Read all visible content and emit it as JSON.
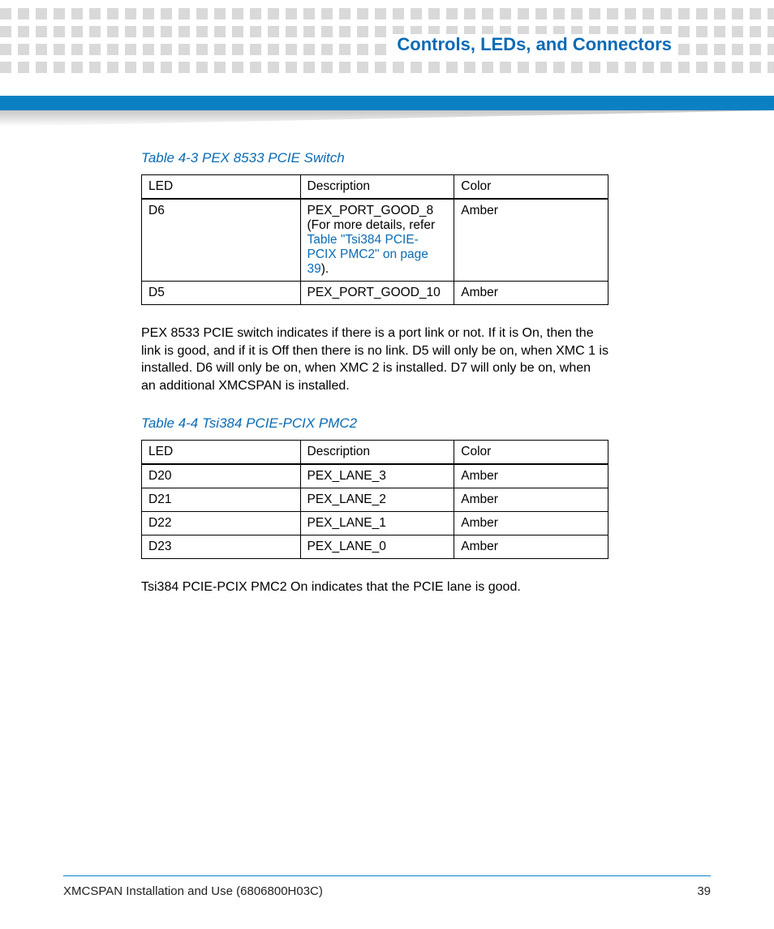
{
  "header": {
    "title": "Controls, LEDs, and Connectors"
  },
  "table1": {
    "caption": "Table 4-3 PEX 8533 PCIE Switch",
    "headers": {
      "led": "LED",
      "desc": "Description",
      "color": "Color"
    },
    "rows": [
      {
        "led": "D6",
        "desc_pre": "PEX_PORT_GOOD_8 (For more details, refer ",
        "desc_link": "Table \"Tsi384 PCIE-PCIX PMC2\" on page 39",
        "desc_post": ").",
        "color": "Amber"
      },
      {
        "led": "D5",
        "desc_pre": "PEX_PORT_GOOD_10",
        "desc_link": "",
        "desc_post": "",
        "color": "Amber"
      }
    ]
  },
  "para1": "PEX 8533 PCIE switch indicates if there is a port link or not. If it is On, then the link is good, and if it is Off then there is no link. D5 will only be on, when XMC 1 is installed. D6 will only be on, when XMC 2 is installed. D7 will only be on, when an additional XMCSPAN is installed.",
  "table2": {
    "caption": "Table 4-4 Tsi384 PCIE-PCIX PMC2",
    "headers": {
      "led": "LED",
      "desc": "Description",
      "color": "Color"
    },
    "rows": [
      {
        "led": "D20",
        "desc": "PEX_LANE_3",
        "color": "Amber"
      },
      {
        "led": "D21",
        "desc": "PEX_LANE_2",
        "color": "Amber"
      },
      {
        "led": "D22",
        "desc": "PEX_LANE_1",
        "color": "Amber"
      },
      {
        "led": "D23",
        "desc": "PEX_LANE_0",
        "color": "Amber"
      }
    ]
  },
  "para2": "Tsi384 PCIE-PCIX PMC2 On indicates that the PCIE lane is good.",
  "footer": {
    "left": "XMCSPAN Installation and Use (6806800H03C)",
    "right": "39"
  }
}
